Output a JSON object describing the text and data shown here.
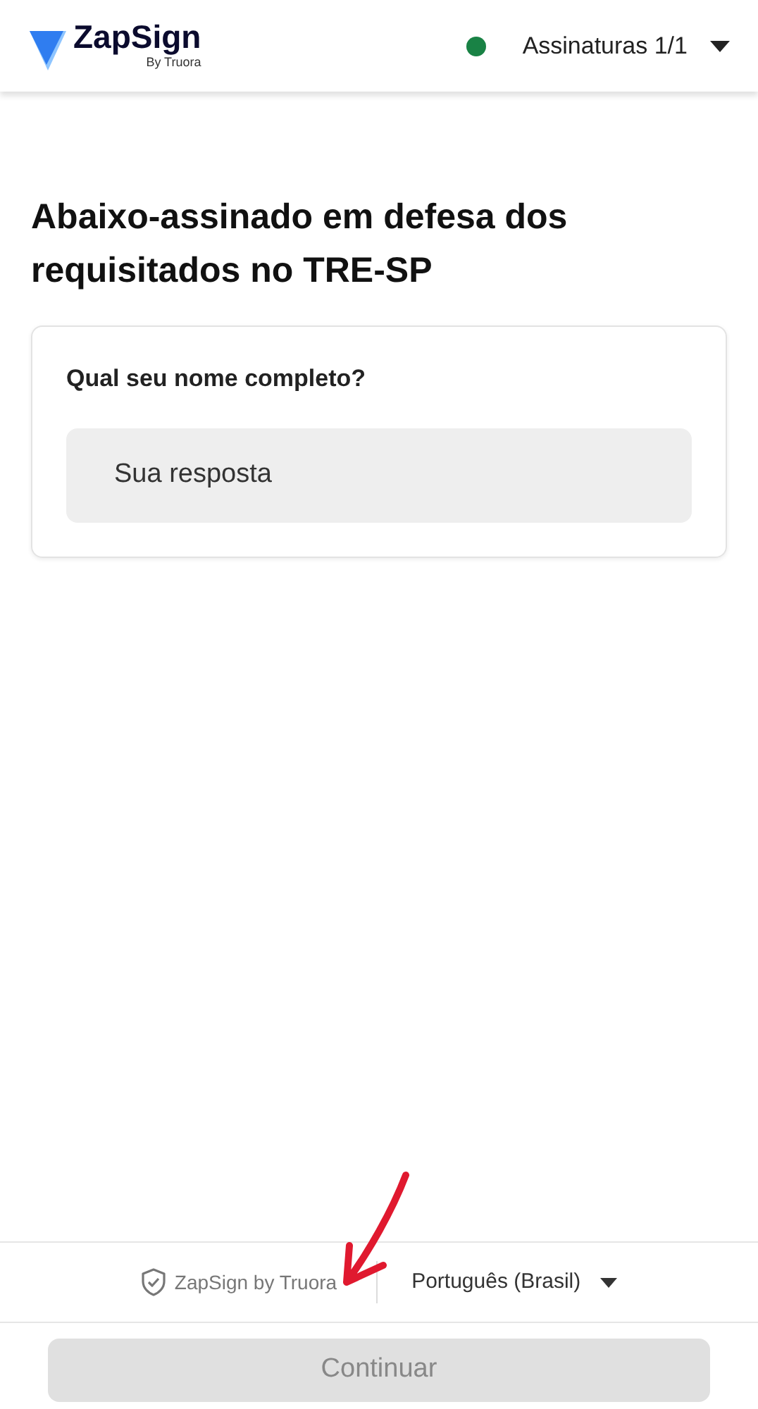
{
  "header": {
    "logo": {
      "name": "ZapSign",
      "byline": "By Truora"
    },
    "signatures": "Assinaturas 1/1"
  },
  "title": "Abaixo-assinado em defesa dos requisitados no TRE-SP",
  "question": {
    "label": "Qual seu nome completo?",
    "placeholder": "Sua resposta"
  },
  "footer": {
    "brand": "ZapSign by Truora",
    "language": "Português (Brasil)"
  },
  "continue_button": {
    "label": "Continuar",
    "disabled": true
  }
}
